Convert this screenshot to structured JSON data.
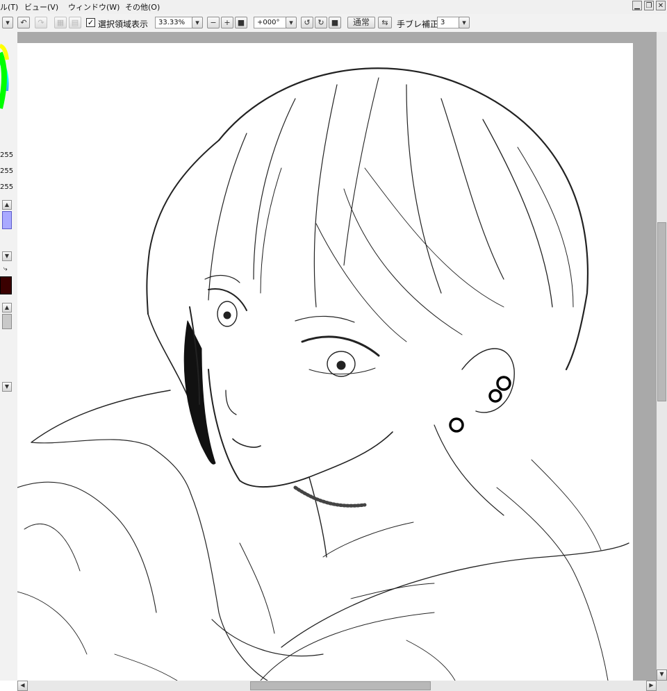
{
  "menu": {
    "tool_partial": "ル(T)",
    "view": "ビュー(V)",
    "window": "ウィンドウ(W)",
    "other": "その他(O)"
  },
  "window_controls": {
    "minimize": "▁",
    "restore": "❐",
    "close": "✕"
  },
  "toolbar": {
    "show_selection_label": "選択領域表示",
    "show_selection_checked": true,
    "zoom_value": "33.33%",
    "rotation_value": "+000°",
    "blend_mode": "通常",
    "stabilizer_label": "手ブレ補正",
    "stabilizer_value": "3"
  },
  "left_panel": {
    "rgb_values": [
      "255",
      "255",
      "255"
    ],
    "primary_color": "#3a0000",
    "slider_color": "#a9a9ff"
  },
  "icons": {
    "undo": "undo-icon",
    "redo": "redo-icon",
    "zoom_minus": "minus-icon",
    "zoom_plus": "plus-icon",
    "rotate_ccw": "rotate-left-icon",
    "rotate_cw": "rotate-right-icon",
    "flip": "flip-icon"
  }
}
